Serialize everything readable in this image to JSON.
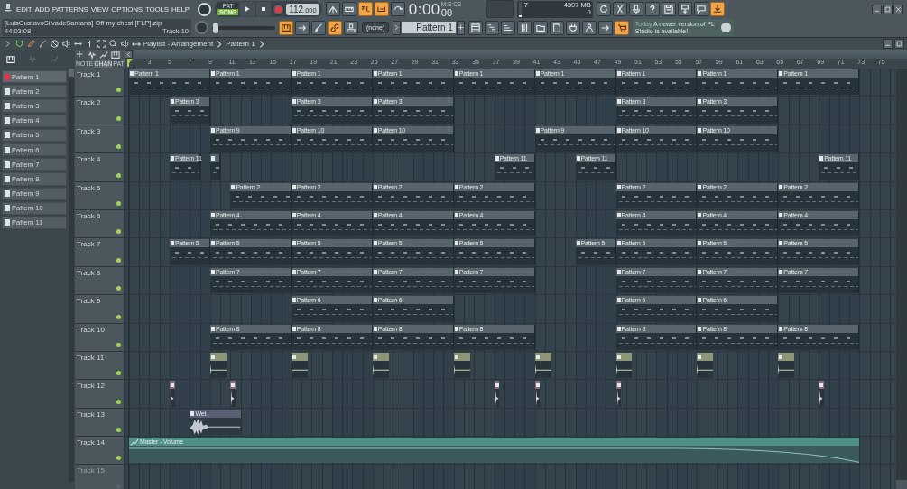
{
  "menu": {
    "items": [
      "EDIT",
      "ADD",
      "PATTERNS",
      "VIEW",
      "OPTIONS",
      "TOOLS",
      "HELP"
    ]
  },
  "transport": {
    "modes": [
      {
        "label": "PAT",
        "selected": false
      },
      {
        "label": "SONG",
        "selected": true
      }
    ],
    "tempo": "112",
    "tempo_decimals": ".000"
  },
  "toolbar_1": [
    {
      "kind": "tune",
      "on": false
    },
    {
      "kind": "keyboard",
      "on": false
    },
    {
      "kind": "countdown",
      "on": true
    },
    {
      "kind": "step",
      "on": true
    },
    {
      "kind": "loop",
      "on": false
    }
  ],
  "clock": {
    "time": "0:00",
    "centiseconds": "00",
    "unit": "M:S:CS"
  },
  "cpu": {
    "value": "7",
    "memory": "4397 MB",
    "polyphony": "0",
    "level": 0.08
  },
  "toolbar_2": [
    {
      "kind": "refresh",
      "on": false
    },
    {
      "kind": "scissors",
      "on": false
    },
    {
      "kind": "mic",
      "on": false
    },
    {
      "kind": "help",
      "label": "?",
      "on": false
    },
    {
      "kind": "disk",
      "on": false
    },
    {
      "kind": "export",
      "on": false
    },
    {
      "kind": "speech",
      "on": false
    },
    {
      "kind": "download",
      "on": true
    }
  ],
  "hint": {
    "text": "[LuisGustavoSilvadeSantana] Off my chest [FLP].zip",
    "time": "44:03:08",
    "target": "Track 10"
  },
  "pitch": {
    "level": 0.02
  },
  "toolbar_3": [
    {
      "kind": "piano",
      "on": true
    },
    {
      "kind": "arrow",
      "on": false
    },
    {
      "kind": "brush",
      "on": false
    },
    {
      "kind": "link",
      "on": true
    },
    {
      "kind": "stamp",
      "on": false
    }
  ],
  "channel_target": "(none)",
  "pattern_selector": "Pattern 1",
  "toolbar_4": [
    {
      "kind": "grid",
      "on": false
    },
    {
      "kind": "pianoroll",
      "on": false
    },
    {
      "kind": "bars",
      "on": false
    },
    {
      "kind": "sliders",
      "on": false
    },
    {
      "kind": "folder",
      "on": false
    },
    {
      "kind": "page",
      "on": false
    },
    {
      "kind": "plug",
      "on": false
    },
    {
      "kind": "person",
      "on": false
    },
    {
      "kind": "arrow",
      "on": false
    },
    {
      "kind": "cart",
      "on": true
    }
  ],
  "news": {
    "date": "Today",
    "message": "A newer version of FL Studio is available!"
  },
  "playlist": {
    "tools": [
      {
        "kind": "magnet",
        "on": true
      },
      {
        "kind": "pencil",
        "on": true
      },
      {
        "kind": "brush",
        "on": false
      },
      {
        "kind": "delete",
        "on": false
      },
      {
        "kind": "mute",
        "on": false
      },
      {
        "kind": "slip",
        "on": false
      },
      {
        "kind": "slice",
        "on": false
      },
      {
        "kind": "select",
        "on": false
      },
      {
        "kind": "zoom",
        "on": false
      },
      {
        "kind": "speaker",
        "on": false
      }
    ],
    "title": "Playlist - Arrangement",
    "pattern": "Pattern 1",
    "picker_tabs": [
      {
        "kind": "piano",
        "selected": true
      },
      {
        "kind": "wave",
        "selected": false
      },
      {
        "kind": "automation",
        "selected": false
      }
    ],
    "filter_tabs": [
      {
        "label": "NOTE",
        "selected": false
      },
      {
        "label": "CHAN",
        "selected": true
      },
      {
        "label": "PAT",
        "selected": false
      }
    ],
    "patterns": [
      {
        "name": "Pattern 1",
        "selected": true
      },
      {
        "name": "Pattern 2",
        "selected": false
      },
      {
        "name": "Pattern 3",
        "selected": false
      },
      {
        "name": "Pattern 4",
        "selected": false
      },
      {
        "name": "Pattern 5",
        "selected": false
      },
      {
        "name": "Pattern 6",
        "selected": false
      },
      {
        "name": "Pattern 7",
        "selected": false
      },
      {
        "name": "Pattern 8",
        "selected": false
      },
      {
        "name": "Pattern 9",
        "selected": false
      },
      {
        "name": "Pattern 10",
        "selected": false
      },
      {
        "name": "Pattern 11",
        "selected": false
      }
    ],
    "ruler": [
      "3",
      "5",
      "7",
      "9",
      "11",
      "13",
      "15",
      "17",
      "19",
      "21",
      "23",
      "25",
      "27",
      "29",
      "31",
      "33",
      "35",
      "37",
      "39",
      "41",
      "43",
      "45",
      "47",
      "49",
      "51",
      "53",
      "55",
      "57",
      "59",
      "61",
      "63",
      "65",
      "67",
      "69",
      "71",
      "73",
      "75"
    ],
    "tracks": [
      {
        "name": "Track 1",
        "dimmed": false,
        "clips": [
          {
            "kind": "pattern",
            "label": "Pattern 1"
          },
          {
            "kind": "pattern",
            "label": "Pattern 1"
          },
          {
            "kind": "pattern",
            "label": "Pattern 1"
          },
          {
            "kind": "pattern",
            "label": "Pattern 1"
          },
          {
            "kind": "pattern",
            "label": "Pattern 1"
          },
          {
            "kind": "pattern",
            "label": "Pattern 1"
          },
          {
            "kind": "pattern",
            "label": "Pattern 1"
          },
          {
            "kind": "pattern",
            "label": "Pattern 1"
          },
          {
            "kind": "pattern",
            "label": "Pattern 1"
          }
        ]
      },
      {
        "name": "Track 2",
        "dimmed": false,
        "clips": [
          {
            "kind": "pattern",
            "label": "Pattern 3"
          },
          {
            "kind": "pattern",
            "label": "Pattern 3"
          },
          {
            "kind": "pattern",
            "label": "Pattern 3"
          },
          {
            "kind": "pattern",
            "label": "Pattern 3"
          },
          {
            "kind": "pattern",
            "label": "Pattern 3"
          }
        ]
      },
      {
        "name": "Track 3",
        "dimmed": false,
        "clips": [
          {
            "kind": "pattern",
            "label": "Pattern 9"
          },
          {
            "kind": "pattern",
            "label": "Pattern 10"
          },
          {
            "kind": "pattern",
            "label": "Pattern 10"
          },
          {
            "kind": "pattern",
            "label": "Pattern 9"
          },
          {
            "kind": "pattern",
            "label": "Pattern 10"
          },
          {
            "kind": "pattern",
            "label": "Pattern 10"
          }
        ]
      },
      {
        "name": "Track 4",
        "dimmed": false,
        "clips": [
          {
            "kind": "pattern",
            "label": "Pattern 11"
          },
          {
            "kind": "pattern"
          },
          {
            "kind": "pattern",
            "label": "Pattern 11"
          },
          {
            "kind": "pattern",
            "label": "Pattern 11"
          },
          {
            "kind": "pattern",
            "label": "Pattern 11"
          }
        ]
      },
      {
        "name": "Track 5",
        "dimmed": false,
        "clips": [
          {
            "kind": "pattern",
            "label": "Pattern 2"
          },
          {
            "kind": "pattern",
            "label": "Pattern 2"
          },
          {
            "kind": "pattern",
            "label": "Pattern 2"
          },
          {
            "kind": "pattern",
            "label": "Pattern 2"
          },
          {
            "kind": "pattern",
            "label": "Pattern 2"
          },
          {
            "kind": "pattern",
            "label": "Pattern 2"
          },
          {
            "kind": "pattern",
            "label": "Pattern 2"
          }
        ]
      },
      {
        "name": "Track 6",
        "dimmed": false,
        "clips": [
          {
            "kind": "pattern",
            "label": "Pattern 4"
          },
          {
            "kind": "pattern",
            "label": "Pattern 4"
          },
          {
            "kind": "pattern",
            "label": "Pattern 4"
          },
          {
            "kind": "pattern",
            "label": "Pattern 4"
          },
          {
            "kind": "pattern",
            "label": "Pattern 4"
          },
          {
            "kind": "pattern",
            "label": "Pattern 4"
          },
          {
            "kind": "pattern",
            "label": "Pattern 4"
          }
        ]
      },
      {
        "name": "Track 7",
        "dimmed": false,
        "clips": [
          {
            "kind": "pattern",
            "label": "Pattern 5"
          },
          {
            "kind": "pattern",
            "label": "Pattern 5"
          },
          {
            "kind": "pattern",
            "label": "Pattern 5"
          },
          {
            "kind": "pattern",
            "label": "Pattern 5"
          },
          {
            "kind": "pattern",
            "label": "Pattern 5"
          },
          {
            "kind": "pattern",
            "label": "Pattern 5"
          },
          {
            "kind": "pattern",
            "label": "Pattern 5"
          },
          {
            "kind": "pattern",
            "label": "Pattern 5"
          },
          {
            "kind": "pattern",
            "label": "Pattern 5"
          }
        ]
      },
      {
        "name": "Track 8",
        "dimmed": false,
        "clips": [
          {
            "kind": "pattern",
            "label": "Pattern 7"
          },
          {
            "kind": "pattern",
            "label": "Pattern 7"
          },
          {
            "kind": "pattern",
            "label": "Pattern 7"
          },
          {
            "kind": "pattern",
            "label": "Pattern 7"
          },
          {
            "kind": "pattern",
            "label": "Pattern 7"
          },
          {
            "kind": "pattern",
            "label": "Pattern 7"
          },
          {
            "kind": "pattern",
            "label": "Pattern 7"
          }
        ]
      },
      {
        "name": "Track 9",
        "dimmed": false,
        "clips": [
          {
            "kind": "pattern",
            "label": "Pattern 6"
          },
          {
            "kind": "pattern",
            "label": "Pattern 6"
          },
          {
            "kind": "pattern",
            "label": "Pattern 6"
          },
          {
            "kind": "pattern",
            "label": "Pattern 6"
          }
        ]
      },
      {
        "name": "Track 10",
        "dimmed": false,
        "clips": [
          {
            "kind": "pattern",
            "label": "Pattern 8"
          },
          {
            "kind": "pattern",
            "label": "Pattern 8"
          },
          {
            "kind": "pattern",
            "label": "Pattern 8"
          },
          {
            "kind": "pattern",
            "label": "Pattern 8"
          },
          {
            "kind": "pattern",
            "label": "Pattern 8"
          },
          {
            "kind": "pattern",
            "label": "Pattern 8"
          },
          {
            "kind": "pattern",
            "label": "Pattern 8"
          }
        ]
      },
      {
        "name": "Track 11",
        "dimmed": false,
        "clips": [
          {
            "kind": "audio"
          },
          {
            "kind": "audio"
          },
          {
            "kind": "audio"
          },
          {
            "kind": "audio"
          },
          {
            "kind": "audio"
          },
          {
            "kind": "audio"
          },
          {
            "kind": "audio"
          },
          {
            "kind": "audio"
          }
        ]
      },
      {
        "name": "Track 12",
        "dimmed": false,
        "clips": [
          {
            "kind": "hit"
          },
          {
            "kind": "hit"
          },
          {
            "kind": "hit"
          },
          {
            "kind": "hit"
          },
          {
            "kind": "hit"
          },
          {
            "kind": "hit"
          }
        ]
      },
      {
        "name": "Track 13",
        "dimmed": false,
        "clips": [
          {
            "kind": "vocal",
            "label": "Wet"
          }
        ]
      },
      {
        "name": "Track 14",
        "dimmed": false,
        "clips": [
          {
            "kind": "automation",
            "label": "Master - Volume"
          }
        ]
      },
      {
        "name": "Track 15",
        "dimmed": true
      }
    ]
  }
}
